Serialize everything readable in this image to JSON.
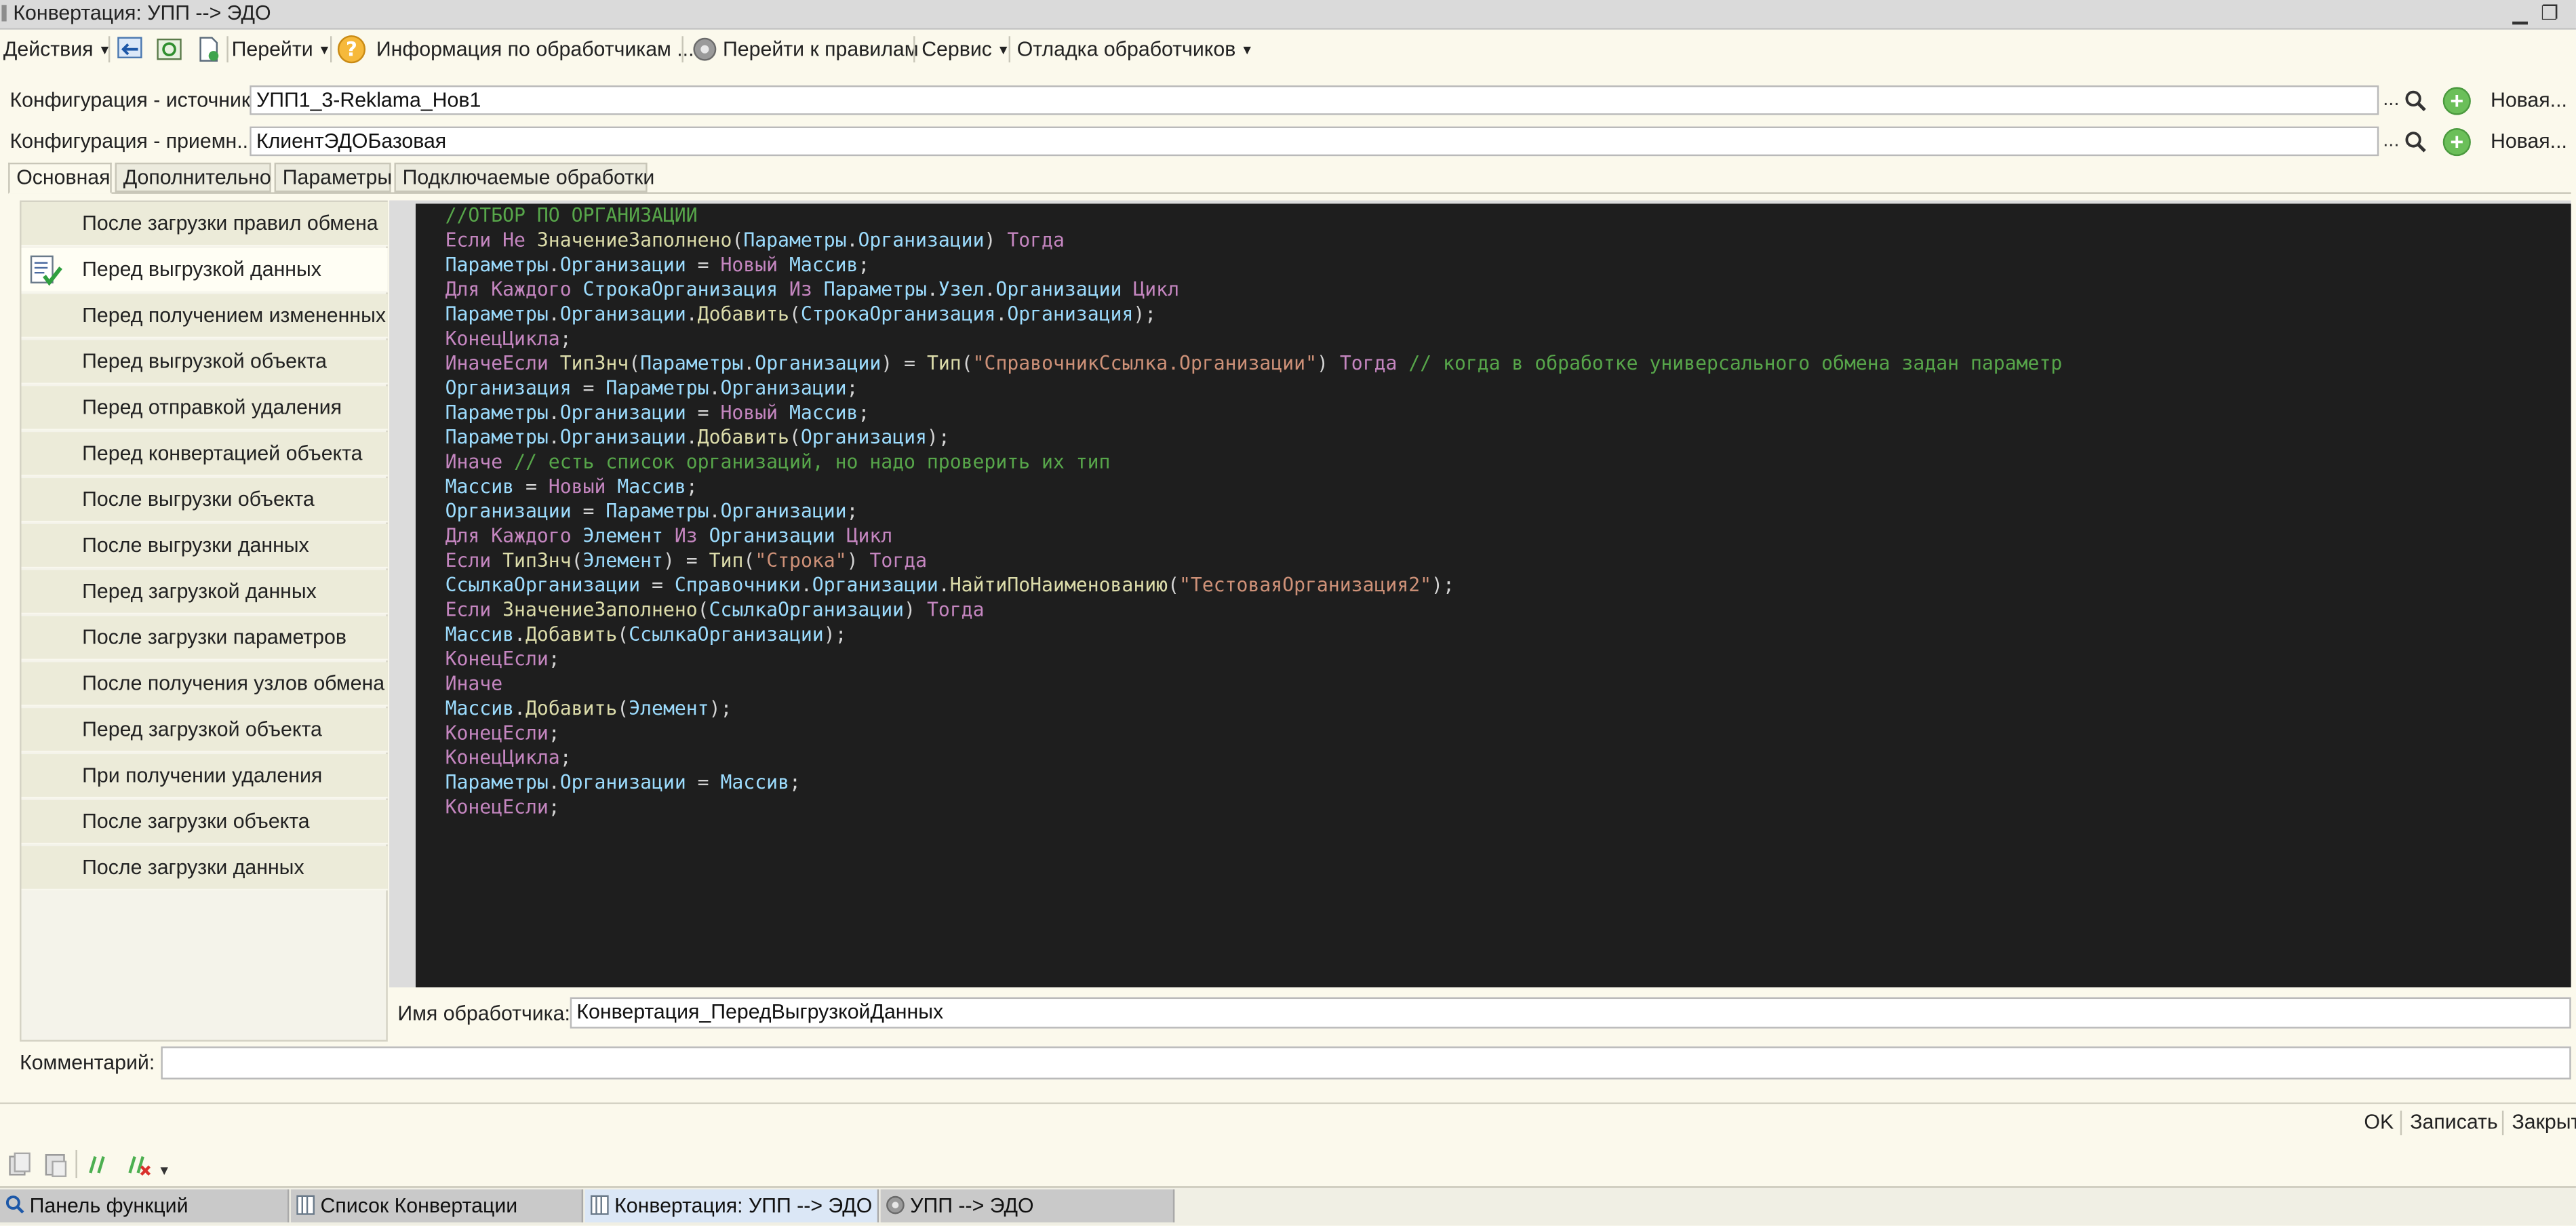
{
  "window": {
    "title": "Конвертация: УПП --> ЭДО"
  },
  "toolbar": {
    "actions": "Действия",
    "goto": "Перейти",
    "handlers_info": "Информация по обработчикам ...",
    "goto_rules": "Перейти к правилам",
    "service": "Сервис",
    "debug": "Отладка обработчиков"
  },
  "config": {
    "source_label": "Конфигурация - источник:",
    "source_value": "УПП1_3-Reklama_Нов1",
    "target_label": "Конфигурация - приемн...",
    "target_value": "КлиентЭДОБазовая",
    "dots": "...",
    "new_label": "Новая..."
  },
  "tabs": [
    "Основная",
    "Дополнительно",
    "Параметры",
    "Подключаемые обработки"
  ],
  "handlers": [
    "После загрузки правил обмена",
    "Перед выгрузкой данных",
    "Перед получением измененных",
    "Перед выгрузкой объекта",
    "Перед отправкой удаления",
    "Перед конвертацией объекта",
    "После выгрузки объекта",
    "После выгрузки данных",
    "Перед загрузкой данных",
    "После загрузки параметров",
    "После получения узлов обмена",
    "Перед загрузкой объекта",
    "При получении удаления",
    "После загрузки объекта",
    "После загрузки данных"
  ],
  "code": {
    "l1": "//ОТБОР ПО ОРГАНИЗАЦИИ",
    "l2": {
      "a": "Если Не ",
      "b": "ЗначениеЗаполнено",
      "c": "(",
      "d": "Параметры",
      "e": ".",
      "f": "Организации",
      "g": ") ",
      "h": "Тогда"
    },
    "l3": {
      "a": "Параметры",
      "b": ".",
      "c": "Организации",
      "d": " = ",
      "e": "Новый",
      "f": " Массив",
      "g": ";"
    },
    "l4": {
      "a": "Для Каждого ",
      "b": "СтрокаОрганизация ",
      "c": "Из ",
      "d": "Параметры",
      "e": ".",
      "f": "Узел",
      "g": ".",
      "h": "Организации ",
      "i": "Цикл"
    },
    "l5": {
      "a": "Параметры",
      "b": ".",
      "c": "Организации",
      "d": ".",
      "e": "Добавить",
      "f": "(",
      "g": "СтрокаОрганизация",
      "h": ".",
      "i": "Организация",
      "j": ");"
    },
    "l6": {
      "a": "КонецЦикла",
      "b": ";"
    },
    "l7": {
      "a": "ИначеЕсли ",
      "b": "ТипЗнч",
      "c": "(",
      "d": "Параметры",
      "e": ".",
      "f": "Организации",
      "g": ") = ",
      "h": "Тип",
      "i": "(",
      "j": "\"СправочникСсылка.Организации\"",
      "k": ") ",
      "l": "Тогда ",
      "m": "// когда в обработке универсального обмена задан параметр"
    },
    "l8": {
      "a": "Организация",
      "b": " = ",
      "c": "Параметры",
      "d": ".",
      "e": "Организации",
      "f": ";"
    },
    "l9": {
      "a": "Параметры",
      "b": ".",
      "c": "Организации",
      "d": " = ",
      "e": "Новый",
      "f": " Массив",
      "g": ";"
    },
    "l10": {
      "a": "Параметры",
      "b": ".",
      "c": "Организации",
      "d": ".",
      "e": "Добавить",
      "f": "(",
      "g": "Организация",
      "h": ");"
    },
    "l11": {
      "a": "Иначе ",
      "b": "// есть список организаций, но надо проверить их тип"
    },
    "l12": {
      "a": "Массив",
      "b": " = ",
      "c": "Новый",
      "d": " Массив",
      "e": ";"
    },
    "l13": {
      "a": "Организации",
      "b": " = ",
      "c": "Параметры",
      "d": ".",
      "e": "Организации",
      "f": ";"
    },
    "l14": {
      "a": "Для Каждого ",
      "b": "Элемент ",
      "c": "Из ",
      "d": "Организации ",
      "e": "Цикл"
    },
    "l15": {
      "a": "Если ",
      "b": "ТипЗнч",
      "c": "(",
      "d": "Элемент",
      "e": ") = ",
      "f": "Тип",
      "g": "(",
      "h": "\"Строка\"",
      "i": ") ",
      "j": "Тогда"
    },
    "l16": {
      "a": "СсылкаОрганизации",
      "b": " = ",
      "c": "Справочники",
      "d": ".",
      "e": "Организации",
      "f": ".",
      "g": "НайтиПоНаименованию",
      "h": "(",
      "i": "\"ТестоваяОрганизация2\"",
      "j": ");"
    },
    "l17": {
      "a": "Если ",
      "b": "ЗначениеЗаполнено",
      "c": "(",
      "d": "СсылкаОрганизации",
      "e": ") ",
      "f": "Тогда"
    },
    "l18": {
      "a": "Массив",
      "b": ".",
      "c": "Добавить",
      "d": "(",
      "e": "СсылкаОрганизации",
      "f": ");"
    },
    "l19": {
      "a": "КонецЕсли",
      "b": ";"
    },
    "l20": "Иначе",
    "l21": {
      "a": "Массив",
      "b": ".",
      "c": "Добавить",
      "d": "(",
      "e": "Элемент",
      "f": ");"
    },
    "l22": {
      "a": "КонецЕсли",
      "b": ";"
    },
    "l23": {
      "a": "КонецЦикла",
      "b": ";"
    },
    "l24": {
      "a": "Параметры",
      "b": ".",
      "c": "Организации",
      "d": " = ",
      "e": "Массив",
      "f": ";"
    },
    "l25": {
      "a": "КонецЕсли",
      "b": ";"
    }
  },
  "handler_name": {
    "label": "Имя обработчика:",
    "value": "Конвертация_ПередВыгрузкойДанных"
  },
  "comment": {
    "label": "Комментарий:",
    "value": ""
  },
  "buttons": {
    "ok": "OK",
    "save": "Записать",
    "close": "Закрыть"
  },
  "taskbar": [
    "Панель функций",
    "Список Конвертации",
    "Конвертация: УПП --> ЭДО",
    "УПП --> ЭДО"
  ]
}
